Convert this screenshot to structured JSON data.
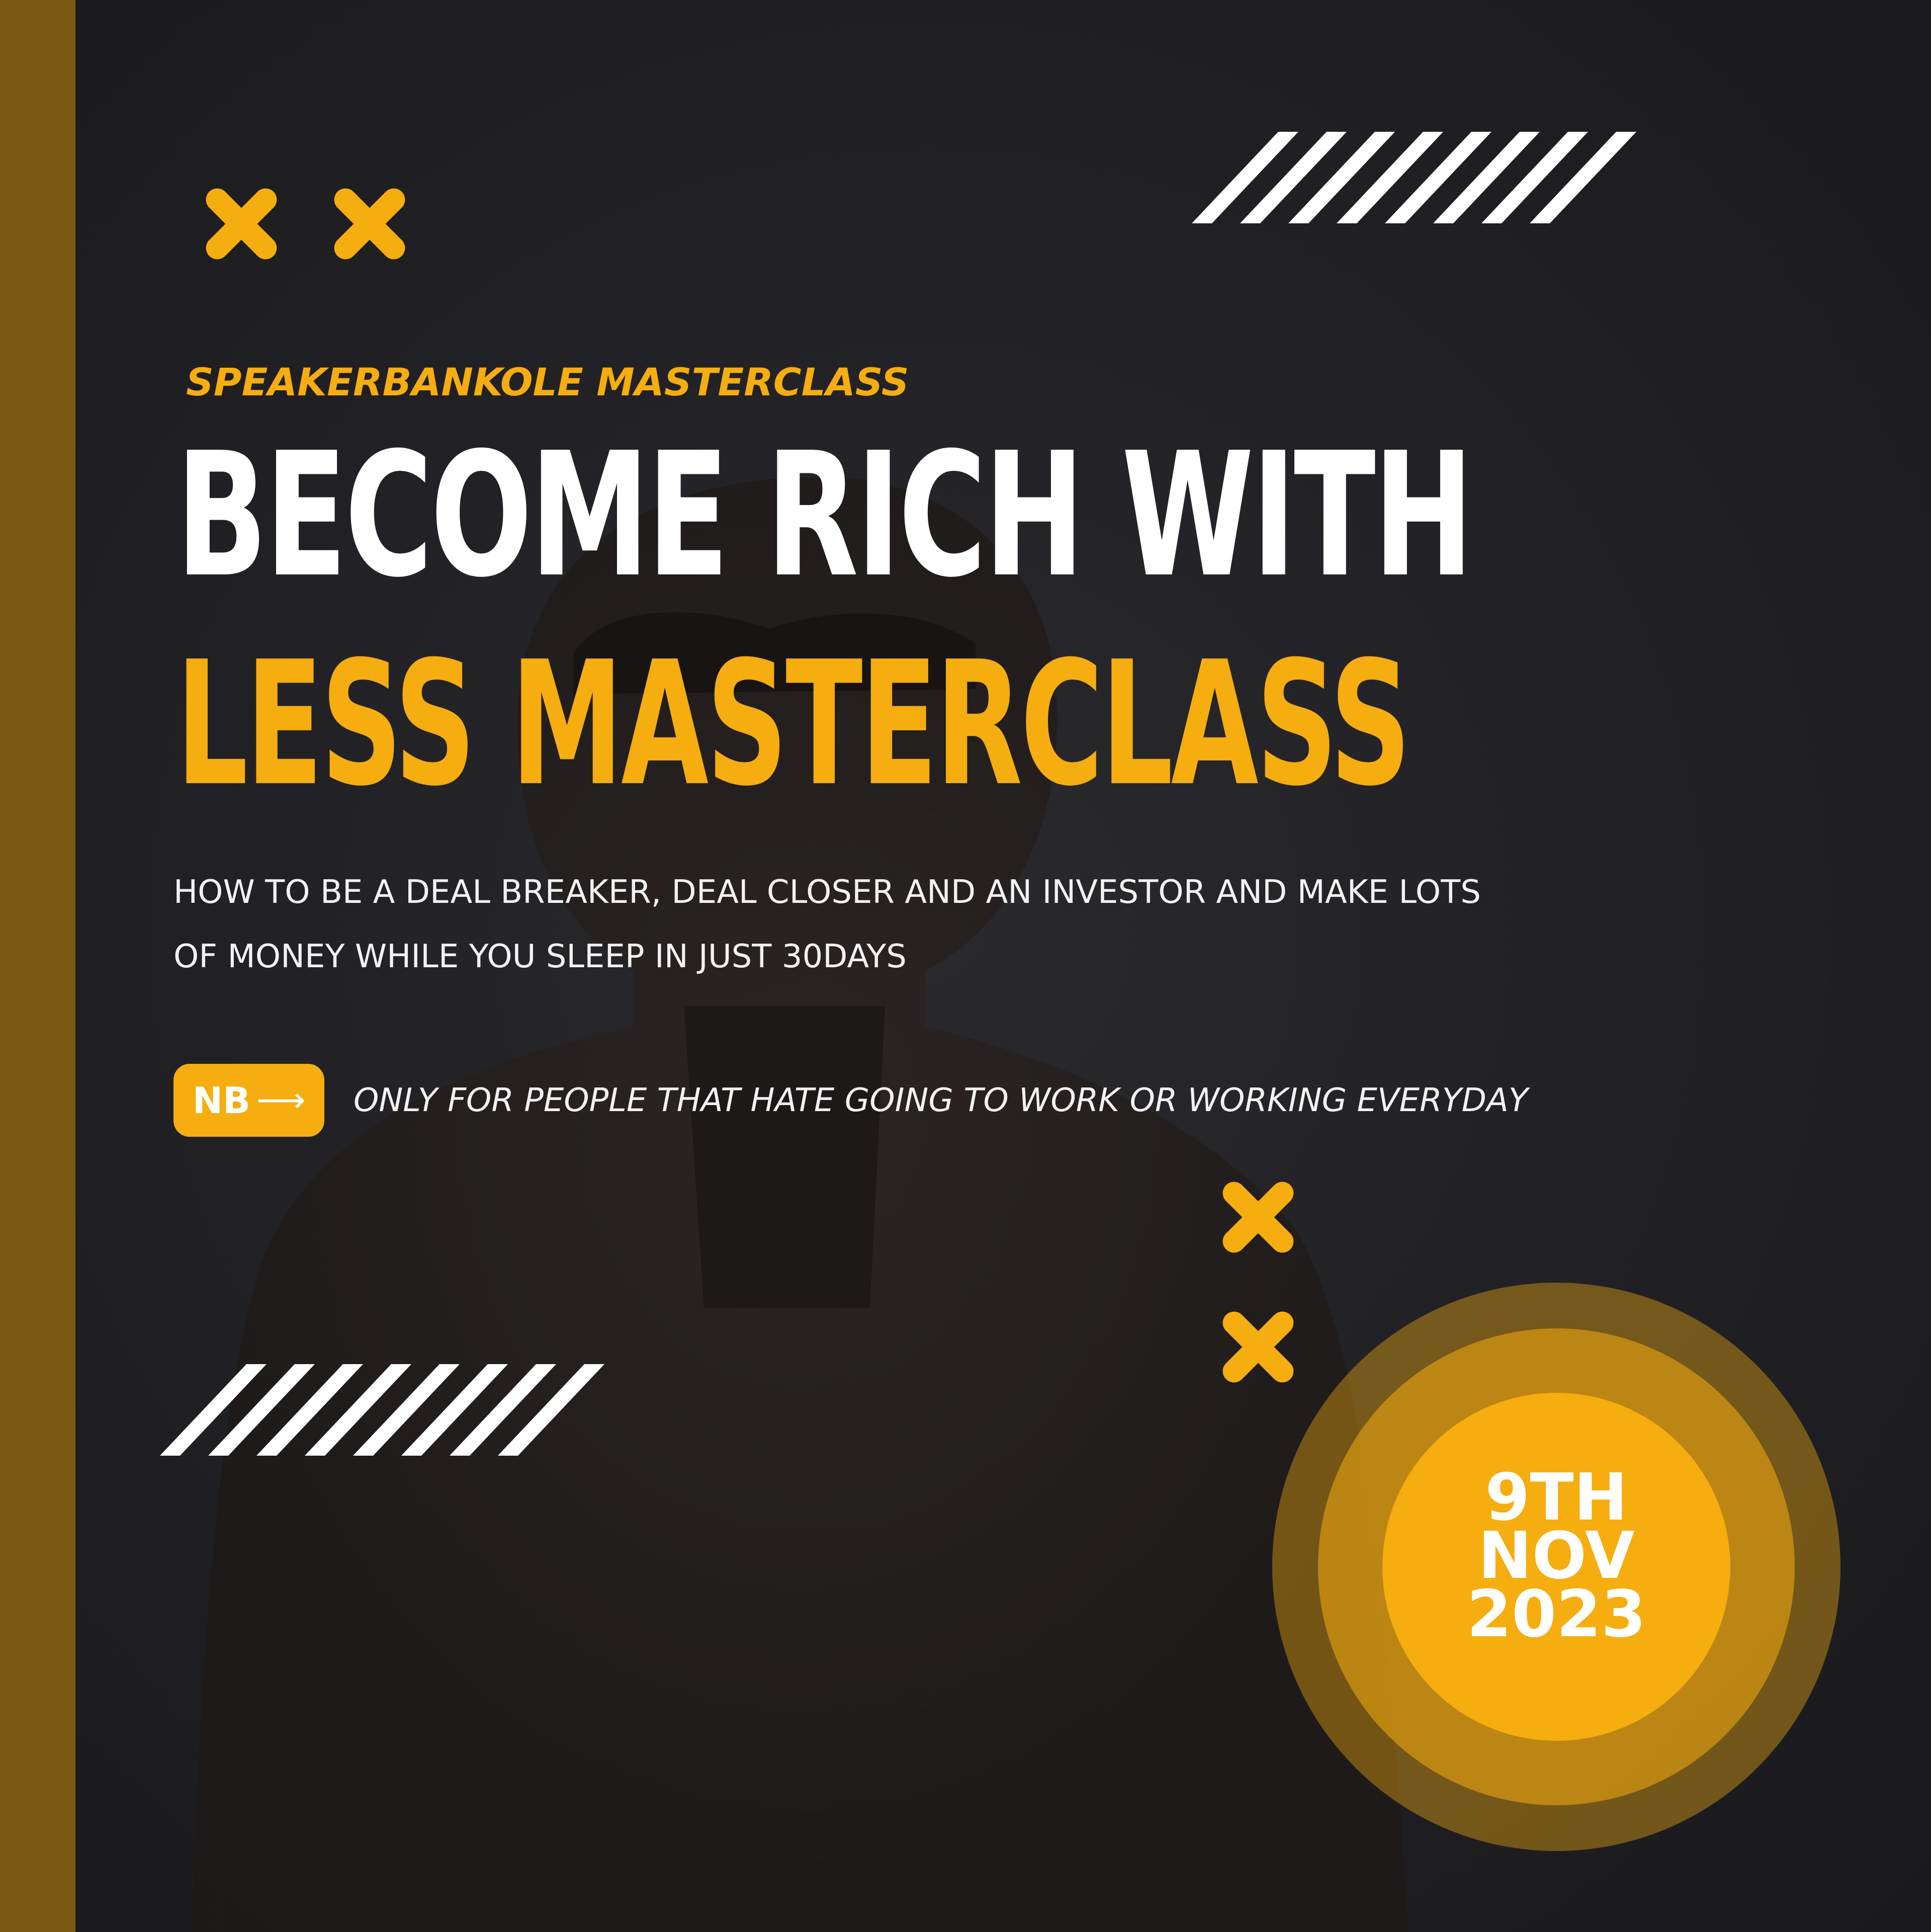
{
  "event": {
    "series_name": "SPEAKERBANKOLE MASTERCLASS",
    "title_line_1": "BECOME RICH WITH",
    "title_line_2": "LESS MASTERCLASS",
    "description_line_1": "HOW TO BE A DEAL BREAKER, DEAL CLOSER AND AN INVESTOR AND MAKE LOTS",
    "description_line_2": "OF MONEY WHILE YOU SLEEP IN JUST 30DAYS",
    "nb_label": "NB",
    "nb_arrow": "⟶",
    "nb_text": "ONLY FOR PEOPLE THAT HATE GOING TO WORK OR WORKING EVERYDAY"
  },
  "date": {
    "day": "9TH",
    "month": "NOV",
    "year": "2023"
  },
  "decor": {
    "icons": [
      "x-mark-icon",
      "stripes-icon"
    ]
  },
  "colors": {
    "accent": "#f5ad0f",
    "background": "#222226",
    "side_bar": "#7a5912",
    "text": "#ffffff"
  }
}
